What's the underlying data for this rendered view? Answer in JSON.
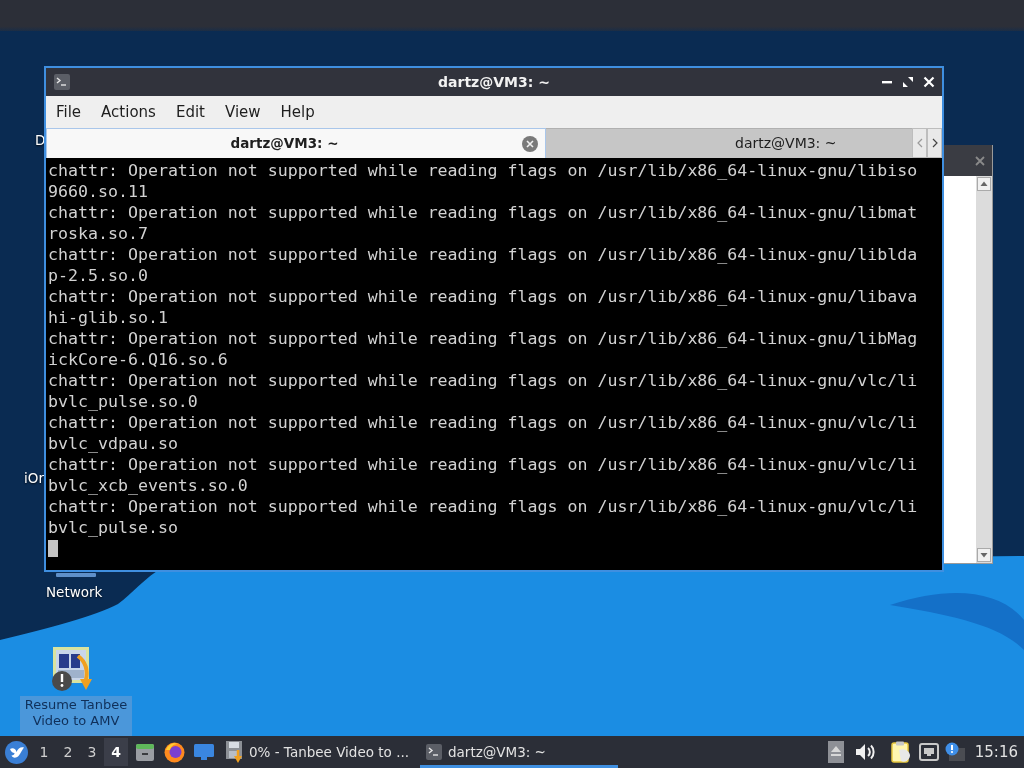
{
  "desktop_icons": [
    {
      "label": "D",
      "kind": "label",
      "selected": false
    },
    {
      "label": "iOr",
      "kind": "label",
      "selected": false
    },
    {
      "label": "Network",
      "kind": "network",
      "selected": false
    },
    {
      "label": "Resume Tanbee Video to AMV",
      "kind": "app",
      "selected": true
    }
  ],
  "terminal_window": {
    "title": "dartz@VM3: ~",
    "menu": [
      "File",
      "Actions",
      "Edit",
      "View",
      "Help"
    ],
    "tabs": [
      {
        "label": "dartz@VM3: ~",
        "selected": true
      },
      {
        "label": "dartz@VM3: ~",
        "selected": false
      }
    ],
    "lines": [
      "chattr: Operation not supported while reading flags on /usr/lib/x86_64-linux-gnu/libiso",
      "9660.so.11",
      "chattr: Operation not supported while reading flags on /usr/lib/x86_64-linux-gnu/libmat",
      "roska.so.7",
      "chattr: Operation not supported while reading flags on /usr/lib/x86_64-linux-gnu/liblda",
      "p-2.5.so.0",
      "chattr: Operation not supported while reading flags on /usr/lib/x86_64-linux-gnu/libava",
      "hi-glib.so.1",
      "chattr: Operation not supported while reading flags on /usr/lib/x86_64-linux-gnu/libMag",
      "ickCore-6.Q16.so.6",
      "chattr: Operation not supported while reading flags on /usr/lib/x86_64-linux-gnu/vlc/li",
      "bvlc_pulse.so.0",
      "chattr: Operation not supported while reading flags on /usr/lib/x86_64-linux-gnu/vlc/li",
      "bvlc_vdpau.so",
      "chattr: Operation not supported while reading flags on /usr/lib/x86_64-linux-gnu/vlc/li",
      "bvlc_xcb_events.so.0",
      "chattr: Operation not supported while reading flags on /usr/lib/x86_64-linux-gnu/vlc/li",
      "bvlc_pulse.so"
    ]
  },
  "taskbar": {
    "workspaces": [
      {
        "label": "1",
        "selected": false
      },
      {
        "label": "2",
        "selected": false
      },
      {
        "label": "3",
        "selected": false
      },
      {
        "label": "4",
        "selected": true
      }
    ],
    "tasks": [
      {
        "label": "0% - Tanbee Video to ...",
        "kind": "converter",
        "selected": false
      },
      {
        "label": "dartz@VM3: ~",
        "kind": "terminal",
        "selected": true
      }
    ],
    "clock": "15:16"
  }
}
